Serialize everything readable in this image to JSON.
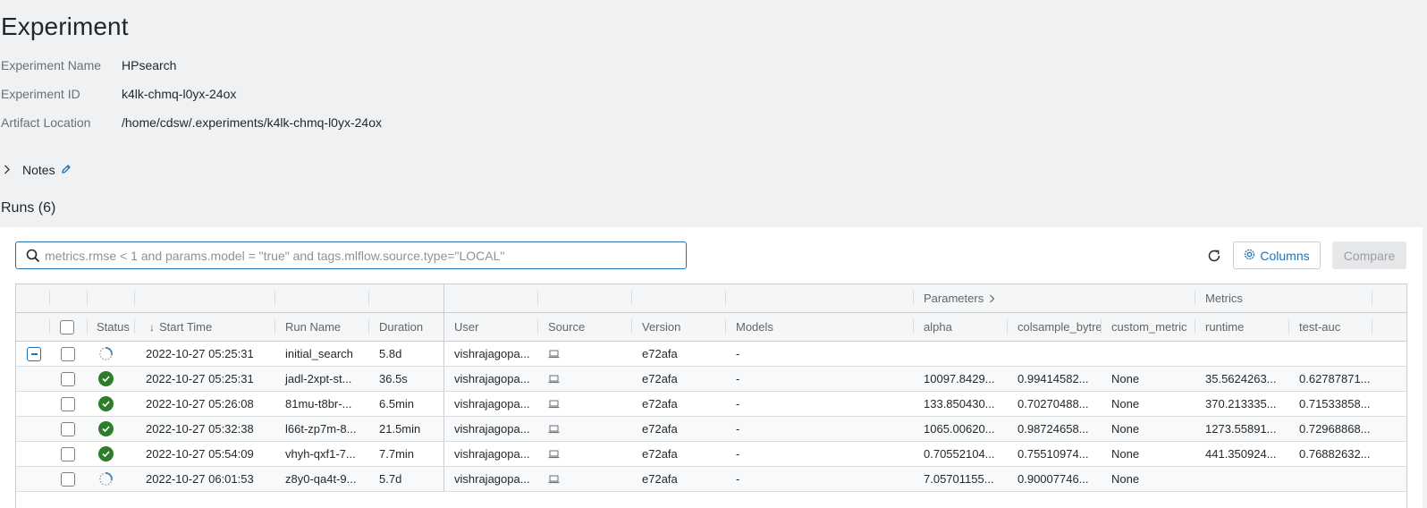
{
  "page": {
    "title": "Experiment",
    "meta": [
      {
        "label": "Experiment Name",
        "value": "HPsearch"
      },
      {
        "label": "Experiment ID",
        "value": "k4lk-chmq-l0yx-24ox"
      },
      {
        "label": "Artifact Location",
        "value": "/home/cdsw/.experiments/k4lk-chmq-l0yx-24ox"
      }
    ],
    "notes_label": "Notes",
    "runs_title": "Runs (6)"
  },
  "toolbar": {
    "search_placeholder": "metrics.rmse < 1 and params.model = \"true\" and tags.mlflow.source.type=\"LOCAL\"",
    "search_value": "",
    "columns_label": "Columns",
    "compare_label": "Compare"
  },
  "table": {
    "group_headers": {
      "parameters": "Parameters",
      "metrics": "Metrics"
    },
    "columns": {
      "status": "Status",
      "start_time": "Start Time",
      "run_name": "Run Name",
      "duration": "Duration",
      "user": "User",
      "source": "Source",
      "version": "Version",
      "models": "Models",
      "alpha": "alpha",
      "colsample": "colsample_bytre",
      "custom_metric": "custom_metric",
      "runtime": "runtime",
      "test_auc": "test-auc"
    },
    "sort_indicator": "↓",
    "rows": [
      {
        "status": "running",
        "start_time": "2022-10-27 05:25:31",
        "run_name": "initial_search",
        "duration": "5.8d",
        "user": "vishrajagopa...",
        "version": "e72afa",
        "models": "-",
        "alpha": "",
        "colsample": "",
        "custom_metric": "",
        "runtime": "",
        "test_auc": "",
        "expandable": true
      },
      {
        "status": "finished",
        "start_time": "2022-10-27 05:25:31",
        "run_name": "jadl-2xpt-st...",
        "duration": "36.5s",
        "user": "vishrajagopa...",
        "version": "e72afa",
        "models": "-",
        "alpha": "10097.8429...",
        "colsample": "0.99414582...",
        "custom_metric": "None",
        "runtime": "35.5624263...",
        "test_auc": "0.62787871..."
      },
      {
        "status": "finished",
        "start_time": "2022-10-27 05:26:08",
        "run_name": "81mu-t8br-...",
        "duration": "6.5min",
        "user": "vishrajagopa...",
        "version": "e72afa",
        "models": "-",
        "alpha": "133.850430...",
        "colsample": "0.70270488...",
        "custom_metric": "None",
        "runtime": "370.213335...",
        "test_auc": "0.71533858..."
      },
      {
        "status": "finished",
        "start_time": "2022-10-27 05:32:38",
        "run_name": "l66t-zp7m-8...",
        "duration": "21.5min",
        "user": "vishrajagopa...",
        "version": "e72afa",
        "models": "-",
        "alpha": "1065.00620...",
        "colsample": "0.98724658...",
        "custom_metric": "None",
        "runtime": "1273.55891...",
        "test_auc": "0.72968868..."
      },
      {
        "status": "finished",
        "start_time": "2022-10-27 05:54:09",
        "run_name": "vhyh-qxf1-7...",
        "duration": "7.7min",
        "user": "vishrajagopa...",
        "version": "e72afa",
        "models": "-",
        "alpha": "0.70552104...",
        "colsample": "0.75510974...",
        "custom_metric": "None",
        "runtime": "441.350924...",
        "test_auc": "0.76882632..."
      },
      {
        "status": "running",
        "start_time": "2022-10-27 06:01:53",
        "run_name": "z8y0-qa4t-9...",
        "duration": "5.7d",
        "user": "vishrajagopa...",
        "version": "e72afa",
        "models": "-",
        "alpha": "7.05701155...",
        "colsample": "0.90007746...",
        "custom_metric": "None",
        "runtime": "",
        "test_auc": ""
      }
    ]
  },
  "colors": {
    "accent": "#2272b4",
    "success": "#2d7d2d",
    "page_bg": "#f0f1f3"
  }
}
